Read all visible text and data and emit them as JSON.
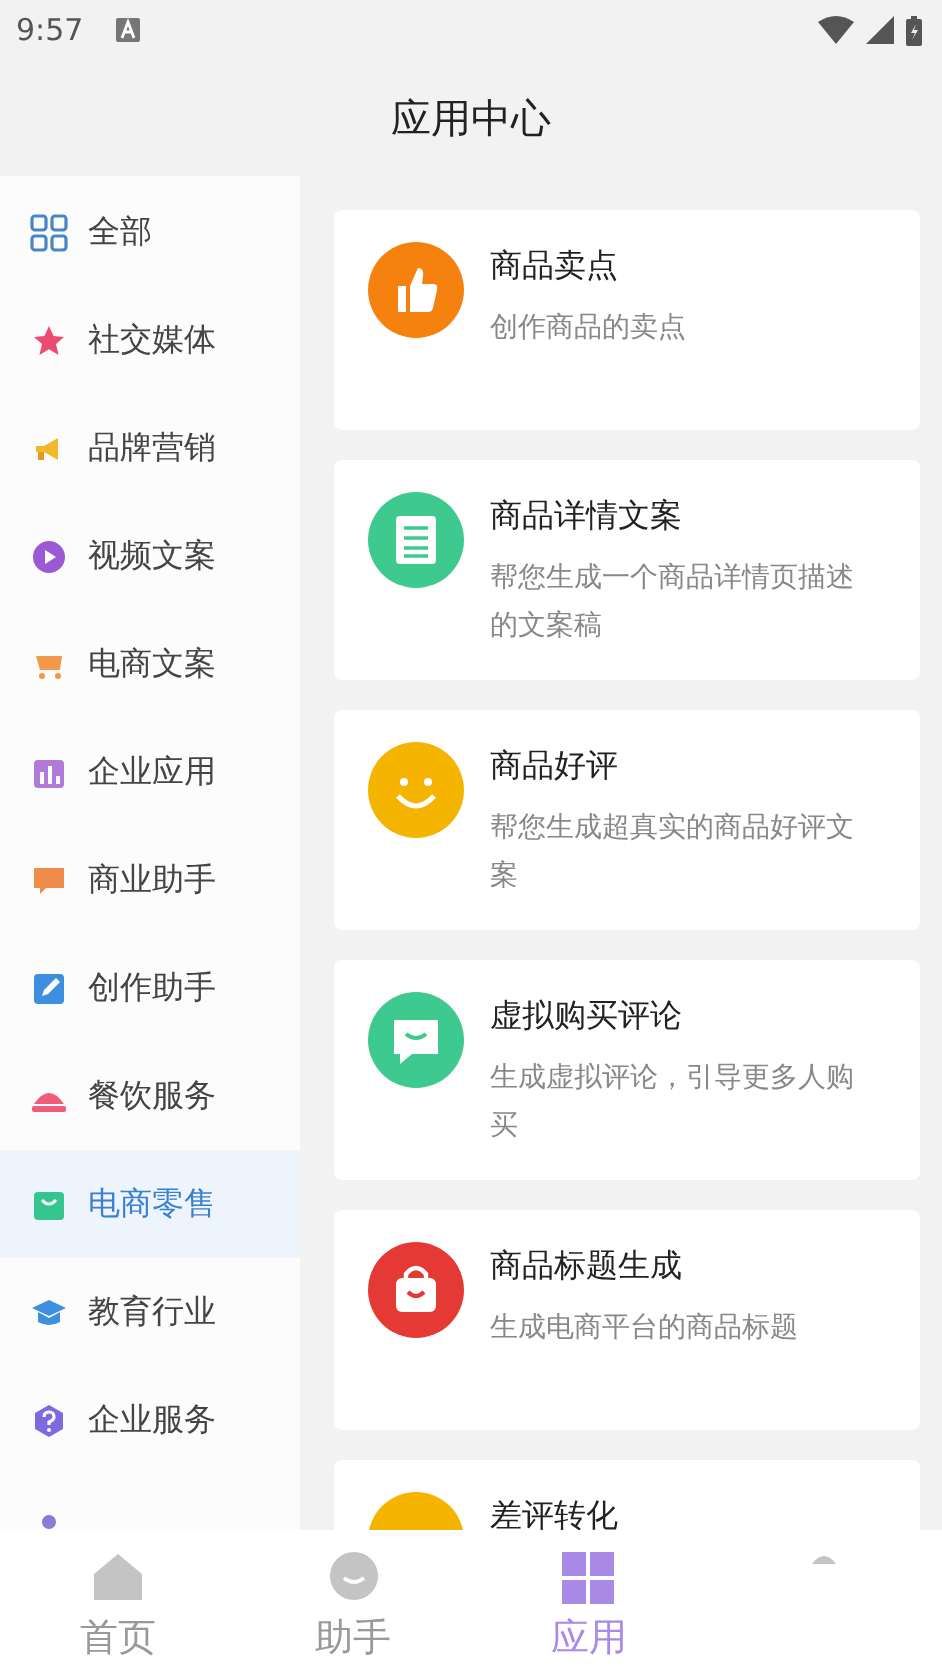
{
  "status_bar": {
    "time": "9:57"
  },
  "header": {
    "title": "应用中心"
  },
  "sidebar": {
    "items": [
      {
        "label": "全部",
        "selected": false
      },
      {
        "label": "社交媒体",
        "selected": false
      },
      {
        "label": "品牌营销",
        "selected": false
      },
      {
        "label": "视频文案",
        "selected": false
      },
      {
        "label": "电商文案",
        "selected": false
      },
      {
        "label": "企业应用",
        "selected": false
      },
      {
        "label": "商业助手",
        "selected": false
      },
      {
        "label": "创作助手",
        "selected": false
      },
      {
        "label": "餐饮服务",
        "selected": false
      },
      {
        "label": "电商零售",
        "selected": true
      },
      {
        "label": "教育行业",
        "selected": false
      },
      {
        "label": "企业服务",
        "selected": false
      },
      {
        "selected": false
      }
    ]
  },
  "cards": [
    {
      "title": "商品卖点",
      "description": "创作商品的卖点"
    },
    {
      "title": "商品详情文案",
      "description": "帮您生成一个商品详情页描述的文案稿"
    },
    {
      "title": "商品好评",
      "description": "帮您生成超真实的商品好评文案"
    },
    {
      "title": "虚拟购买评论",
      "description": "生成虚拟评论，引导更多人购买"
    },
    {
      "title": "商品标题生成",
      "description": "生成电商平台的商品标题"
    },
    {
      "title": "差评转化"
    }
  ],
  "tab_bar": [
    {
      "label": "首页",
      "selected": false
    },
    {
      "label": "助手",
      "selected": false
    },
    {
      "label": "应用",
      "selected": true
    },
    {
      "selected": false
    }
  ]
}
